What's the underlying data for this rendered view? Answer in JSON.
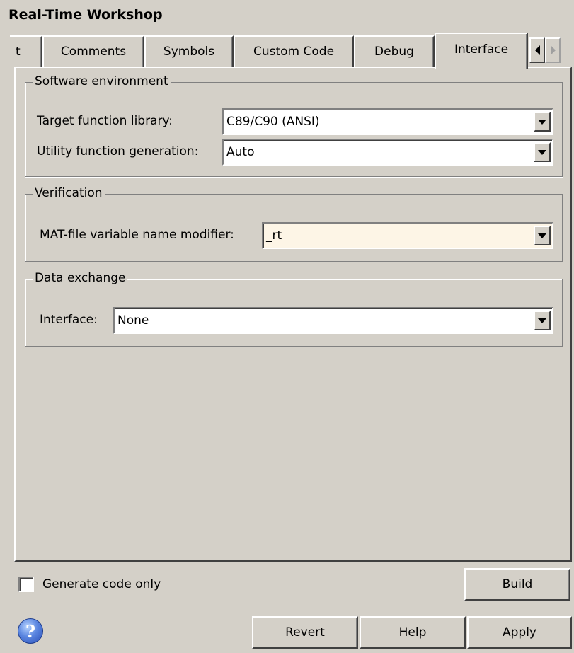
{
  "window": {
    "title": "Real-Time Workshop"
  },
  "tabs": [
    {
      "label": "t",
      "active": false
    },
    {
      "label": "Comments",
      "active": false
    },
    {
      "label": "Symbols",
      "active": false
    },
    {
      "label": "Custom Code",
      "active": false
    },
    {
      "label": "Debug",
      "active": false
    },
    {
      "label": "Interface",
      "active": true
    }
  ],
  "tab_scroll": {
    "left_icon": "triangle-left-icon",
    "right_icon": "triangle-right-icon"
  },
  "sections": {
    "software_environment": {
      "title": "Software environment",
      "target_function_library": {
        "label": "Target function library:",
        "value": "C89/C90 (ANSI)"
      },
      "utility_function_generation": {
        "label": "Utility function generation:",
        "value": "Auto"
      }
    },
    "verification": {
      "title": "Verification",
      "mat_file_modifier": {
        "label": "MAT-file variable name modifier:",
        "value": "_rt"
      }
    },
    "data_exchange": {
      "title": "Data exchange",
      "interface": {
        "label": "Interface:",
        "value": "None"
      }
    }
  },
  "footer": {
    "generate_code_only": {
      "label": "Generate code only",
      "checked": false
    },
    "build_label": "Build",
    "revert": {
      "mnemonic": "R",
      "rest": "evert"
    },
    "help": {
      "mnemonic": "H",
      "rest": "elp"
    },
    "apply": {
      "mnemonic": "A",
      "rest": "pply"
    },
    "help_icon": "question-mark-icon"
  },
  "colors": {
    "dialog_bg": "#d4d0c8",
    "highlight_field": "#fdf5e6"
  }
}
